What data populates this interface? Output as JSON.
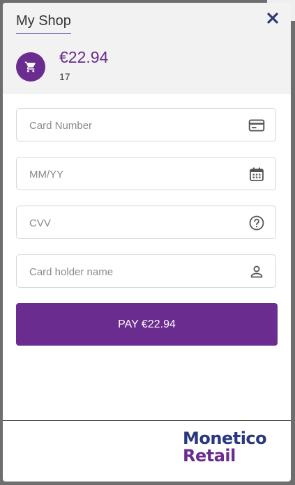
{
  "colors": {
    "accent": "#6a2c8e",
    "close": "#2e3a78",
    "logo_top": "#2b3880",
    "logo_bottom": "#6a2c8e"
  },
  "header": {
    "shop_name": "My Shop",
    "close_icon": "close-icon",
    "cart_icon": "cart-icon",
    "amount": "€22.94",
    "order_ref": "17"
  },
  "form": {
    "card_number": {
      "placeholder": "Card Number",
      "icon": "credit-card-icon"
    },
    "expiry": {
      "placeholder": "MM/YY",
      "icon": "calendar-icon"
    },
    "cvv": {
      "placeholder": "CVV",
      "icon": "help-circle-icon"
    },
    "holder": {
      "placeholder": "Card holder name",
      "icon": "person-icon"
    }
  },
  "pay_button": {
    "label": "PAY €22.94"
  },
  "footer": {
    "logo_line1": "Monetico",
    "logo_line2": "Retail"
  }
}
